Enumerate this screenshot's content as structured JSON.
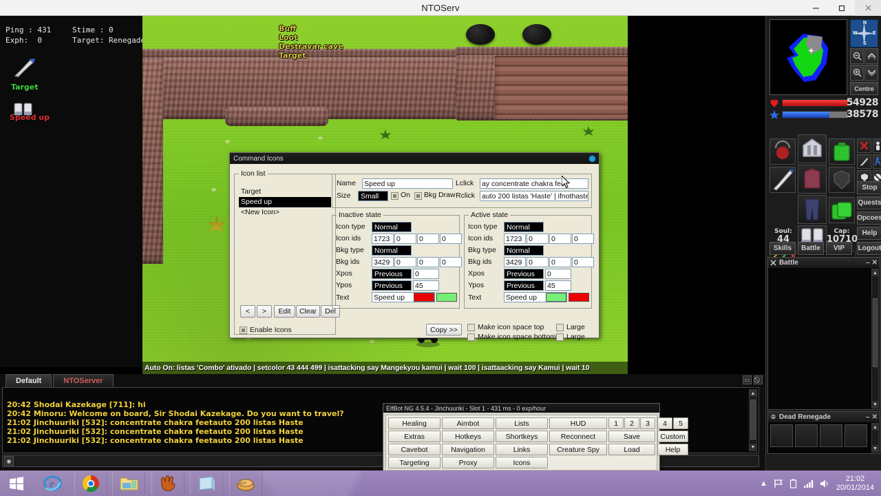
{
  "window": {
    "title": "NTOServ",
    "minimize_label": "minimize",
    "maximize_label": "maximize",
    "close_label": "close"
  },
  "hud": {
    "ping_label": "Ping :",
    "ping_value": "431",
    "exph_label": "Exph:",
    "exph_value": "0",
    "stime_label": "Stime :",
    "stime_value": "0",
    "target_label": "Target:",
    "target_value": "Renegade",
    "line1": "Ping : 431",
    "line2": "Exph:  0",
    "line3": "Stime : 0",
    "line4": "Target: Renegade",
    "icons": [
      {
        "name": "Target",
        "color": "#3fd23f"
      },
      {
        "name": "Speed up",
        "color": "#e03030"
      }
    ]
  },
  "viewport": {
    "overlay_labels": [
      "Buff",
      "Loot",
      "Destravar cave",
      "Target"
    ],
    "status_text": "Auto On: listas 'Combo' ativado | setcolor 43 444 499 | isattacking say Mangekyou kamui | wait 100 | isattaacking say Kamui | wait 10"
  },
  "sidebar": {
    "compass": {
      "n": "N",
      "s": "S",
      "e": "E",
      "w": "W"
    },
    "map_buttons": {
      "zoom_out": "zoom-out",
      "zoom_in": "zoom-in",
      "level_up": "level-up",
      "level_down": "level-down",
      "centre": "Centre"
    },
    "health": {
      "value": "54928",
      "fill_color": "#e01c1c",
      "percent": 100
    },
    "mana": {
      "value": "38578",
      "fill_color": "#1c5ae0",
      "percent": 72
    },
    "soul_label": "Soul:",
    "soul_value": "44",
    "cap_label": "Cap:",
    "cap_value": "10710",
    "buttons": [
      "Stop",
      "Quests",
      "Opcoes",
      "Help",
      "Logout"
    ],
    "tab_buttons": [
      "Skills",
      "Battle",
      "VIP"
    ],
    "state_icons": [
      "cross-icon",
      "person-icon",
      "sword-icon",
      "runner-icon",
      "shield-icon",
      "no-entry-icon"
    ],
    "battle_window": {
      "title": "Battle",
      "minimize": "minimize",
      "close": "close"
    },
    "dead_window": {
      "title": "Dead Renegade",
      "minimize": "minimize",
      "close": "close"
    }
  },
  "command_icons": {
    "title": "Command Icons",
    "icon_list": {
      "legend": "Icon list",
      "items": [
        "Target",
        "Speed up",
        "<New Icon>"
      ],
      "selected_index": 1
    },
    "name_label": "Name",
    "name_value": "Speed up",
    "size_label": "Size",
    "size_value": "Small",
    "on_label": "On",
    "bkgdraw_label": "Bkg Draw",
    "lclick_label": "Lclick",
    "lclick_value": "ay concentrate chakra feet",
    "rclick_label": "Rclick",
    "rclick_value": "auto 200 listas 'Haste' | ifnothaste",
    "inactive": {
      "legend": "Inactive state",
      "icon_type_label": "Icon type",
      "icon_type_value": "Normal",
      "icon_ids_label": "Icon ids",
      "icon_ids": [
        "1723",
        "0",
        "0",
        "0"
      ],
      "bkg_type_label": "Bkg type",
      "bkg_type_value": "Normal",
      "bkg_ids_label": "Bkg ids",
      "bkg_ids": [
        "3429",
        "0",
        "0",
        "0"
      ],
      "xpos_label": "Xpos",
      "xpos_mode": "Previous",
      "xpos_value": "0",
      "ypos_label": "Ypos",
      "ypos_mode": "Previous",
      "ypos_value": "45",
      "text_label": "Text",
      "text_value": "Speed up",
      "color1": "#ee0000",
      "color2": "#77ee77"
    },
    "active": {
      "legend": "Active state",
      "icon_type_label": "Icon type",
      "icon_type_value": "Normal",
      "icon_ids_label": "Icon ids",
      "icon_ids": [
        "1723",
        "0",
        "0",
        "0"
      ],
      "bkg_type_label": "Bkg type",
      "bkg_type_value": "Normal",
      "bkg_ids_label": "Bkg ids",
      "bkg_ids": [
        "3429",
        "0",
        "0",
        "0"
      ],
      "xpos_label": "Xpos",
      "xpos_mode": "Previous",
      "xpos_value": "0",
      "ypos_label": "Ypos",
      "ypos_mode": "Previous",
      "ypos_value": "45",
      "text_label": "Text",
      "text_value": "Speed up",
      "color1": "#77ee77",
      "color2": "#ee0000"
    },
    "nav_prev": "<",
    "nav_next": ">",
    "edit_label": "Edit",
    "clear_label": "Clear",
    "del_label": "Del",
    "enable_icons_label": "Enable Icons",
    "enable_icons_checked": true,
    "copy_label": "Copy >>",
    "make_top_label": "Make icon space top",
    "make_bottom_label": "Make icon space bottom",
    "large_top_label": "Large",
    "large_bottom_label": "Large"
  },
  "chat": {
    "tabs": [
      {
        "label": "Default",
        "active": true,
        "color": "#e7e7e7"
      },
      {
        "label": "NTOServer",
        "active": false,
        "color": "#d05b5b"
      }
    ],
    "lines": [
      "20:42 Shodai Kazekage [711]: hi",
      "20:42 Minoru: Welcome on board, Sir Shodai Kazekage. Do you want to travel?",
      "21:02 Jinchuuriki [532]: concentrate chakra feetauto 200 listas Haste",
      "21:02 Jinchuuriki [532]: concentrate chakra feetauto 200 listas Haste",
      "21:02 Jinchuuriki [532]: concentrate chakra feetauto 200 listas Haste"
    ],
    "text_color": "#f2d23c"
  },
  "elfbot": {
    "title": "ElfBot NG 4.5.4 - Jinchuuriki - Slot 1 - 431 ms - 0 exp/hour",
    "columns": [
      [
        "Healing",
        "Extras",
        "Cavebot",
        "Targeting"
      ],
      [
        "Aimbot",
        "Hotkeys",
        "Navigation",
        "Proxy"
      ],
      [
        "Lists",
        "Shortkeys",
        "Links",
        "Icons"
      ],
      [
        "HUD",
        "Reconnect",
        "Creature Spy"
      ]
    ],
    "slots": [
      "1",
      "2",
      "3",
      "4",
      "5"
    ],
    "save_label": "Save",
    "load_label": "Load",
    "custom_label": "Custom",
    "help_label": "Help"
  },
  "taskbar": {
    "items": [
      "start-icon",
      "internet-explorer-icon",
      "chrome-icon",
      "file-explorer-icon",
      "glove-icon",
      "window-icon",
      "elfbot-icon"
    ],
    "tray": [
      "show-hidden-icon",
      "flag-icon",
      "battery-icon",
      "network-icon",
      "volume-icon"
    ],
    "time": "21:02",
    "date": "20/01/2014"
  }
}
